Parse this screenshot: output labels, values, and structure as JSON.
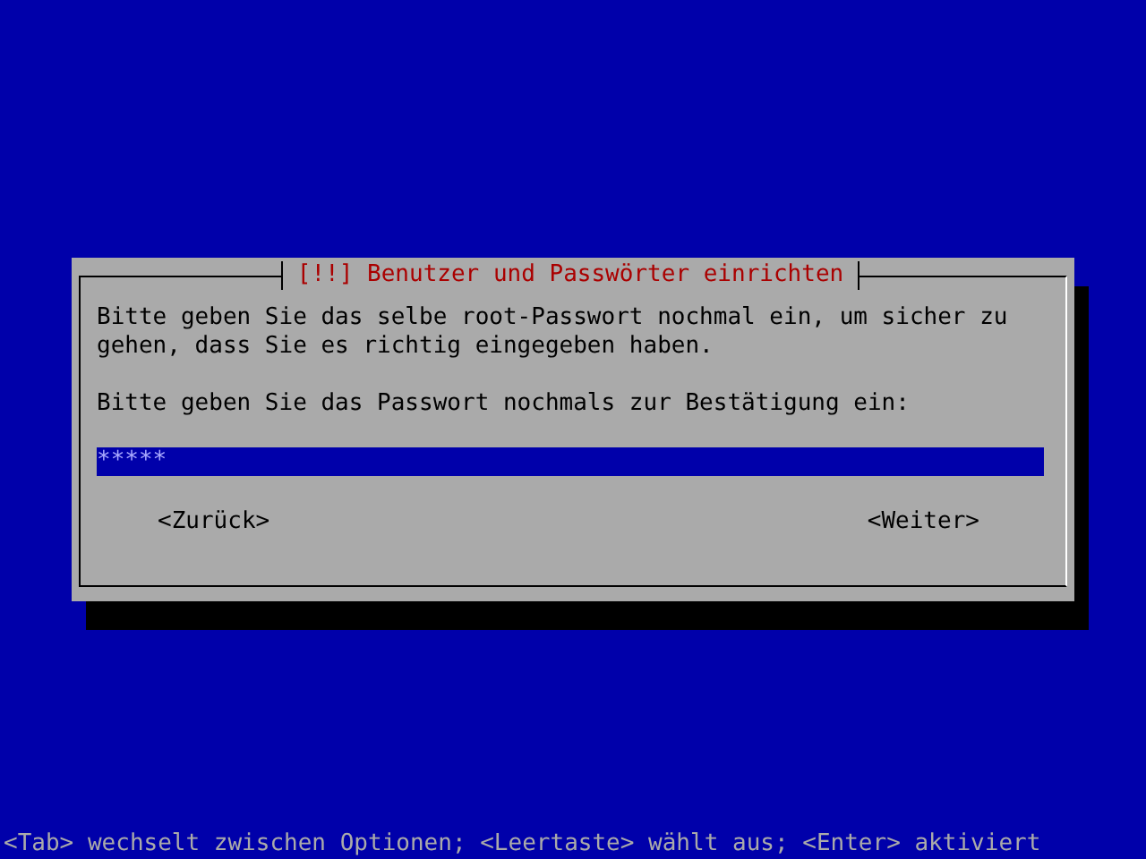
{
  "dialog": {
    "title": "[!!] Benutzer und Passwörter einrichten",
    "message": "Bitte geben Sie das selbe root-Passwort nochmal ein, um sicher zu gehen, dass Sie es richtig eingegeben haben.",
    "prompt": "Bitte geben Sie das Passwort nochmals zur Bestätigung ein:",
    "password_field": {
      "value": "*****"
    },
    "buttons": [
      {
        "label": "<Zurück>",
        "selected": false
      },
      {
        "label": "<Weiter>",
        "selected": false
      }
    ]
  },
  "status_bar": "<Tab> wechselt zwischen Optionen; <Leertaste> wählt aus; <Enter> aktiviert"
}
